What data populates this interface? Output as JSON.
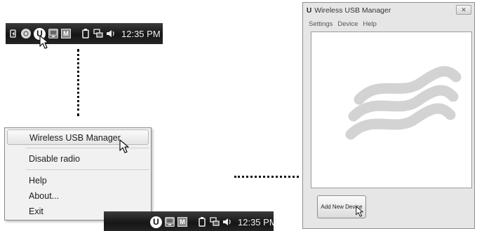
{
  "taskbar_top": {
    "icons": [
      "battery-icon",
      "globe-icon",
      "wireless-usb-manager-icon",
      "display-icon",
      "m-icon"
    ],
    "system_icons": [
      "power-icon",
      "network-icon",
      "volume-icon"
    ],
    "clock": "12:35 PM"
  },
  "taskbar_bottom": {
    "clock": "12:35 PM"
  },
  "tray_glyphs": {
    "wusb": "U",
    "m": "M"
  },
  "context_menu": {
    "items": [
      {
        "label": "Wireless USB Manager",
        "highlighted": true
      },
      {
        "label": "Disable radio"
      },
      {
        "label": "Help"
      },
      {
        "label": "About..."
      },
      {
        "label": "Exit"
      }
    ]
  },
  "window": {
    "app_glyph": "U",
    "title": "Wireless USB Manager",
    "close_glyph": "✕",
    "menu": [
      "Settings",
      "Device",
      "Help"
    ],
    "add_device_label": "Add New Device"
  },
  "colors": {
    "taskbar": "#1f1f1f",
    "menu_bg": "#f1f1f1",
    "window_bg": "#e6e6e6",
    "wave": "#cfcfcf"
  }
}
